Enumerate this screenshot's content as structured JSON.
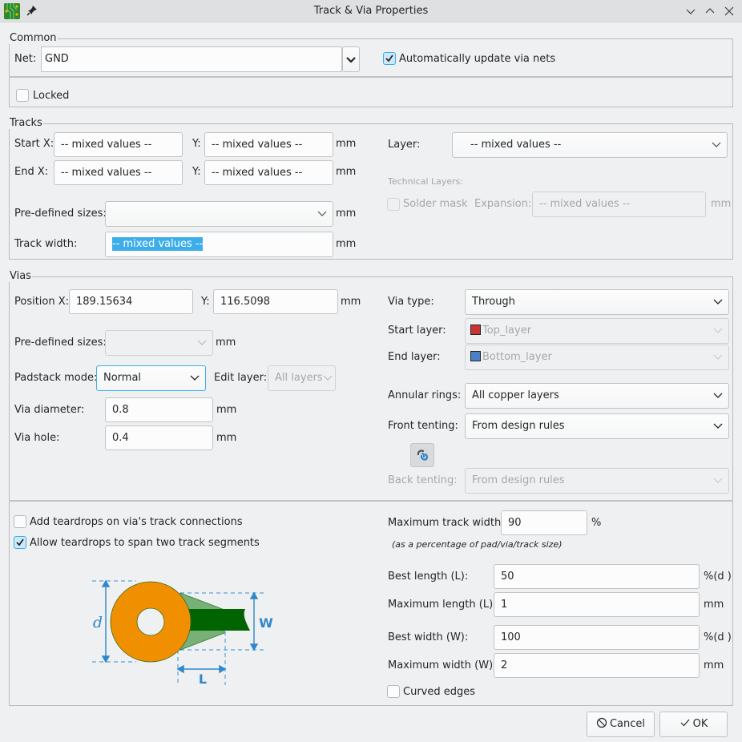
{
  "window": {
    "title": "Track & Via Properties",
    "controls": [
      "minimize",
      "maximize",
      "close"
    ]
  },
  "common": {
    "group_label": "Common",
    "net_label": "Net:",
    "net_value": "GND",
    "auto_update_label": "Automatically update via nets",
    "auto_update_checked": true,
    "locked_label": "Locked",
    "locked_checked": false
  },
  "tracks": {
    "group_label": "Tracks",
    "start_x_label": "Start X:",
    "start_x_value": "-- mixed values --",
    "start_y_label": "Y:",
    "start_y_value": "-- mixed values --",
    "end_x_label": "End X:",
    "end_x_value": "-- mixed values --",
    "end_y_label": "Y:",
    "end_y_value": "-- mixed values --",
    "unit": "mm",
    "predefined_label": "Pre-defined sizes:",
    "predefined_value": "",
    "width_label": "Track width:",
    "width_value": "-- mixed values --",
    "layer_label": "Layer:",
    "layer_value": "-- mixed values --",
    "technical_layers_label": "Technical Layers:",
    "solder_mask_label": "Solder mask",
    "solder_mask_checked": false,
    "expansion_label": "Expansion:",
    "expansion_value": "-- mixed values --"
  },
  "vias": {
    "group_label": "Vias",
    "pos_x_label": "Position X:",
    "pos_x_value": "189.15634",
    "pos_y_label": "Y:",
    "pos_y_value": "116.5098",
    "unit": "mm",
    "predefined_label": "Pre-defined sizes:",
    "predefined_value": "",
    "padstack_label": "Padstack mode:",
    "padstack_value": "Normal",
    "edit_layer_label": "Edit layer:",
    "edit_layer_value": "All layers",
    "diameter_label": "Via diameter:",
    "diameter_value": "0.8",
    "hole_label": "Via hole:",
    "hole_value": "0.4",
    "via_type_label": "Via type:",
    "via_type_value": "Through",
    "start_layer_label": "Start layer:",
    "start_layer_value": "Top_layer",
    "start_layer_color": "#c83434",
    "end_layer_label": "End layer:",
    "end_layer_value": "Bottom_layer",
    "end_layer_color": "#4d7fc4",
    "annular_label": "Annular rings:",
    "annular_value": "All copper layers",
    "front_tenting_label": "Front tenting:",
    "front_tenting_value": "From design rules",
    "back_tenting_label": "Back tenting:",
    "back_tenting_value": "From design rules"
  },
  "teardrops": {
    "add_label": "Add teardrops on via's track connections",
    "add_checked": false,
    "span_label": "Allow teardrops to span two track segments",
    "span_checked": true,
    "diagram": {
      "d_label": "d",
      "w_label": "W",
      "l_label": "L"
    },
    "max_track_width_label": "Maximum track width:",
    "max_track_width_value": "90",
    "max_track_width_unit": "%",
    "percentage_note": "(as a percentage of pad/via/track size)",
    "best_length_label": "Best length (L):",
    "best_length_value": "50",
    "best_length_unit": "%(d )",
    "max_length_label": "Maximum length (L):",
    "max_length_value": "1",
    "max_length_unit": "mm",
    "best_width_label": "Best width (W):",
    "best_width_value": "100",
    "best_width_unit": "%(d )",
    "max_width_label": "Maximum width (W):",
    "max_width_value": "2",
    "max_width_unit": "mm",
    "curved_label": "Curved edges",
    "curved_checked": false
  },
  "buttons": {
    "cancel_label": "Cancel",
    "ok_label": "OK"
  },
  "colors": {
    "accent": "#3daee9",
    "pad_orange": "#f09000",
    "track_green": "#006400",
    "teardrop_green": "#78b078",
    "dimension_blue": "#2f87cc"
  }
}
